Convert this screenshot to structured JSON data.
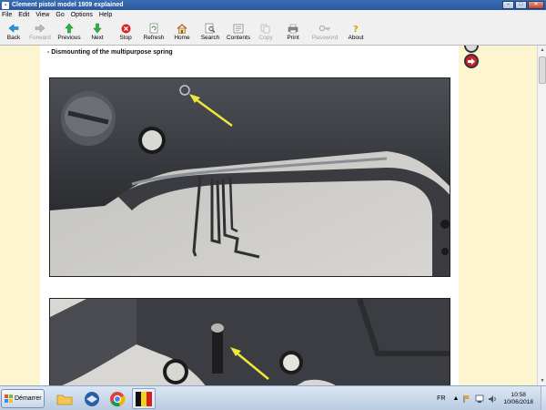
{
  "window": {
    "title": "Clement pistol model 1909 explained"
  },
  "menu": [
    "File",
    "Edit",
    "View",
    "Go",
    "Options",
    "Help"
  ],
  "toolbar": [
    {
      "label": "Back",
      "icon": "back-arrow-icon",
      "enabled": true
    },
    {
      "label": "Forward",
      "icon": "forward-arrow-icon",
      "enabled": false
    },
    {
      "label": "Previous",
      "icon": "up-arrow-icon",
      "enabled": true
    },
    {
      "label": "Next",
      "icon": "down-arrow-icon",
      "enabled": true
    },
    {
      "label": "Stop",
      "icon": "stop-icon",
      "enabled": true
    },
    {
      "label": "Refresh",
      "icon": "refresh-icon",
      "enabled": true
    },
    {
      "label": "Home",
      "icon": "home-icon",
      "enabled": true
    },
    {
      "label": "Search",
      "icon": "search-icon",
      "enabled": true
    },
    {
      "label": "Contents",
      "icon": "contents-icon",
      "enabled": true
    },
    {
      "label": "Copy",
      "icon": "copy-icon",
      "enabled": false
    },
    {
      "label": "Print",
      "icon": "print-icon",
      "enabled": true
    },
    {
      "label": "Password",
      "icon": "key-icon",
      "enabled": false
    },
    {
      "label": "About",
      "icon": "about-icon",
      "enabled": true
    }
  ],
  "content": {
    "heading": "- Dismounting of the multipurpose spring",
    "page_bg": "#fdf4d0"
  },
  "taskbar": {
    "start_label": "Démarrer",
    "language": "FR",
    "time": "10:58",
    "date": "10/06/2018",
    "apps": [
      "explorer-icon",
      "thunderbird-icon",
      "chrome-icon",
      "ebook-app-icon"
    ]
  }
}
